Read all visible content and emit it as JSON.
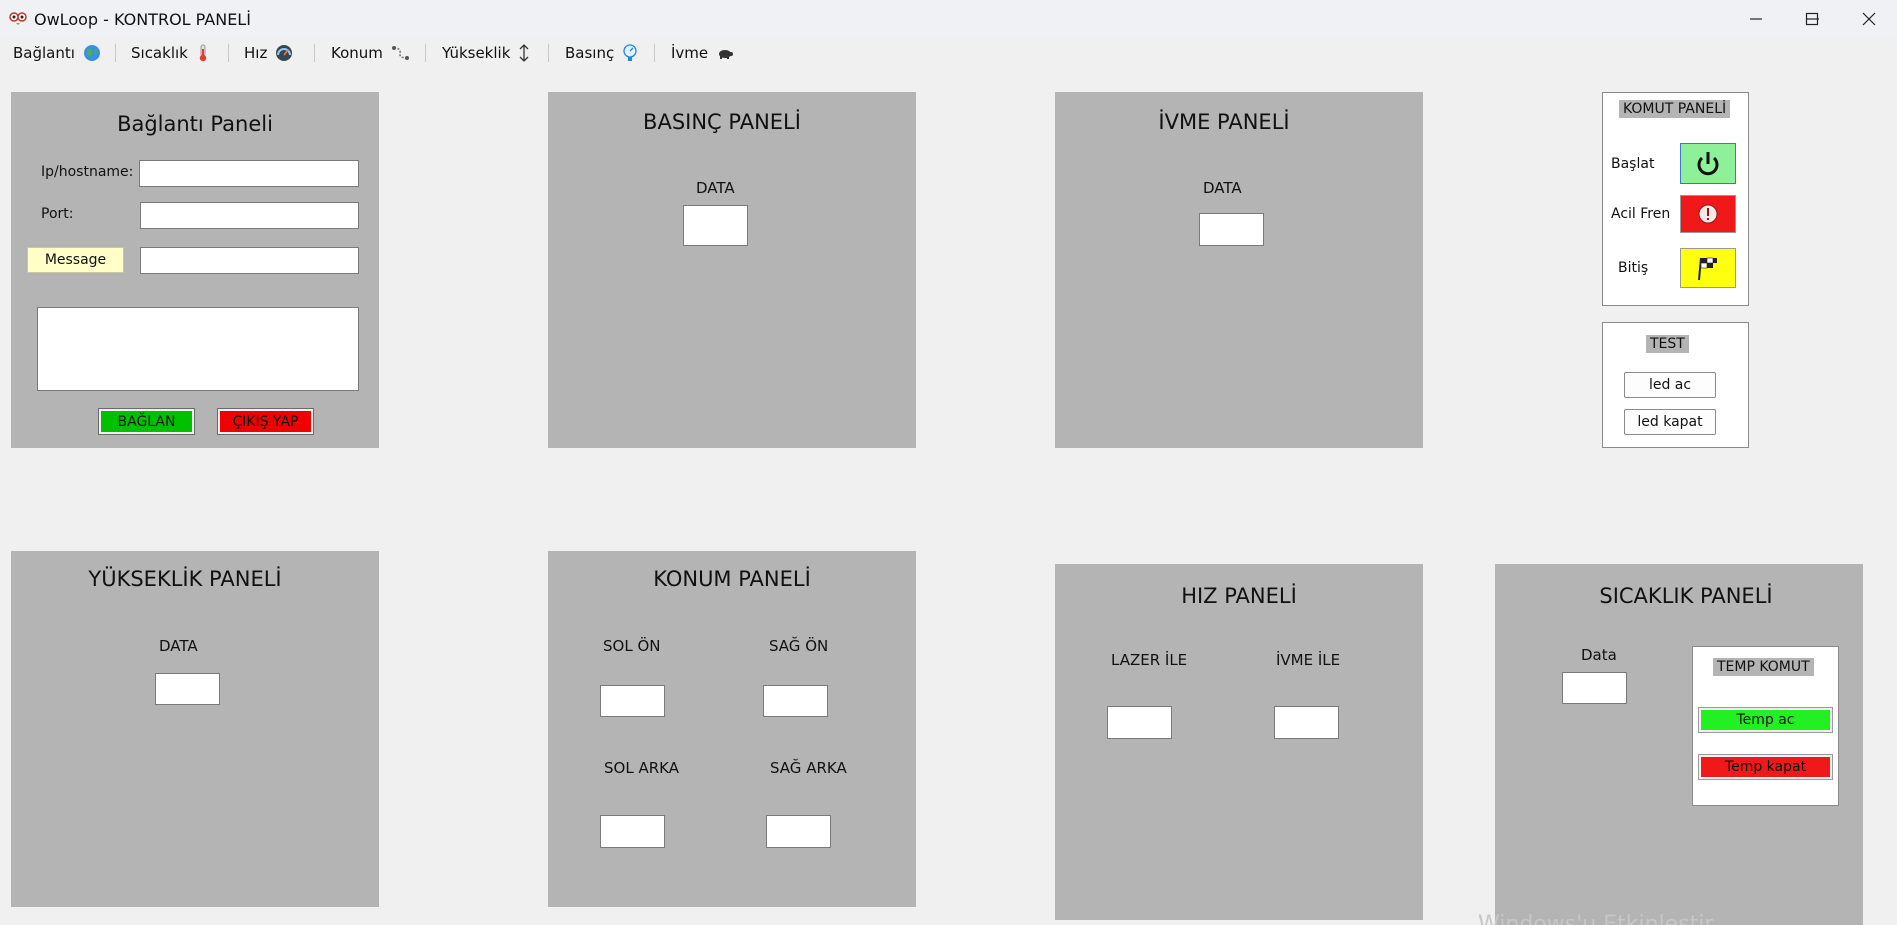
{
  "window": {
    "title": "OwLoop - KONTROL PANELİ",
    "minimize": "—",
    "maximize": "☐",
    "close": "✕"
  },
  "toolbar": [
    {
      "label": "Bağlantı",
      "icon": "globe-icon"
    },
    {
      "label": "Sıcaklık",
      "icon": "thermometer-icon"
    },
    {
      "label": "Hız",
      "icon": "speedometer-icon"
    },
    {
      "label": "Konum",
      "icon": "route-icon"
    },
    {
      "label": "Yükseklik",
      "icon": "vertical-arrows-icon"
    },
    {
      "label": "Basınç",
      "icon": "pressure-icon"
    },
    {
      "label": "İvme",
      "icon": "turtle-icon"
    }
  ],
  "connection": {
    "title": "Bağlantı Paneli",
    "ip_label": "Ip/hostname:",
    "port_label": "Port:",
    "message_button": "Message",
    "ip_value": "",
    "port_value": "",
    "message_value": "",
    "log_value": "",
    "connect_button": "BAĞLAN",
    "exit_button": "ÇIKIŞ YAP"
  },
  "pressure": {
    "title": "BASINÇ PANELİ",
    "data_label": "DATA",
    "data_value": ""
  },
  "acceleration": {
    "title": "İVME PANELİ",
    "data_label": "DATA",
    "data_value": ""
  },
  "command": {
    "title": "KOMUT PANELİ",
    "start_label": "Başlat",
    "brake_label": "Acil Fren",
    "finish_label": "Bitiş",
    "start_color": "#8ff09a",
    "brake_color": "#f01818",
    "finish_color": "#ffff10"
  },
  "test": {
    "title": "TEST",
    "led_on": "led ac",
    "led_off": "led kapat"
  },
  "altitude": {
    "title": "YÜKSEKLİK PANELİ",
    "data_label": "DATA",
    "data_value": ""
  },
  "position": {
    "title": "KONUM PANELİ",
    "front_left": "SOL ÖN",
    "front_right": "SAĞ ÖN",
    "rear_left": "SOL ARKA",
    "rear_right": "SAĞ ARKA"
  },
  "speed": {
    "title": "HIZ PANELİ",
    "laser_label": "LAZER İLE",
    "accel_label": "İVME İLE"
  },
  "temperature": {
    "title": "SICAKLIK PANELİ",
    "data_label": "Data",
    "data_value": "",
    "command_title": "TEMP KOMUT",
    "temp_on": "Temp ac",
    "temp_off": "Temp kapat",
    "on_color": "#22f022",
    "off_color": "#f01818"
  },
  "colors": {
    "panel": "#b4b4b4",
    "connect": "#00c000",
    "exit": "#f00000",
    "message": "#ffffc8"
  },
  "watermark": "Windows'u Etkinleştir"
}
